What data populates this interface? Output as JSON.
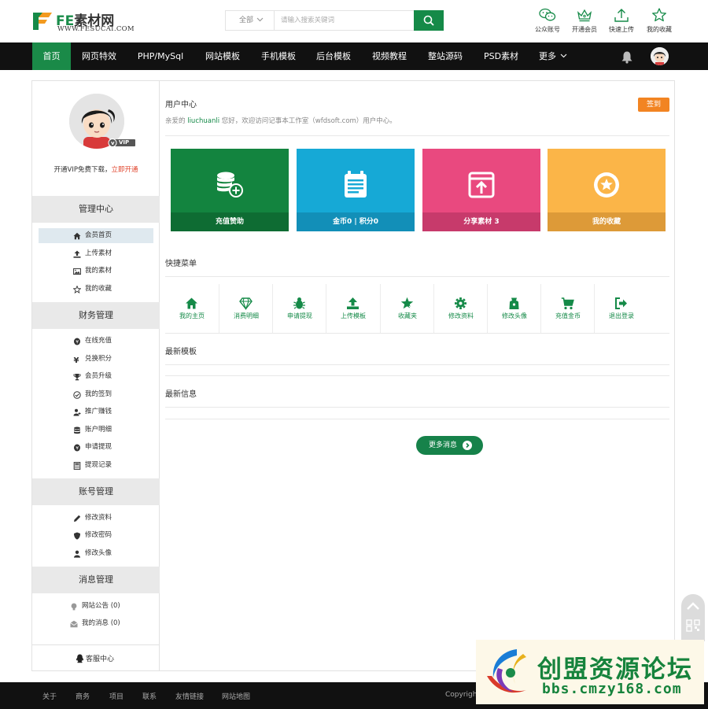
{
  "header": {
    "logo_fe": "FE",
    "logo_cn": "素材网",
    "logo_url": "WWW.FESUCAI.COM",
    "search": {
      "category": "全部",
      "placeholder": "请输入搜索关键词"
    },
    "quick_links": [
      {
        "label": "公众账号",
        "icon": "wechat-icon"
      },
      {
        "label": "开通会员",
        "icon": "crown-icon"
      },
      {
        "label": "快速上传",
        "icon": "upload-icon"
      },
      {
        "label": "我的收藏",
        "icon": "star-icon"
      }
    ]
  },
  "nav": {
    "items": [
      "首页",
      "网页特效",
      "PHP/MySql",
      "网站模板",
      "手机模板",
      "后台模板",
      "视频教程",
      "整站源码",
      "PSD素材",
      "更多"
    ],
    "active": "首页"
  },
  "sidebar": {
    "vip_badge": "VIP",
    "vip_text": "开通VIP免费下载，",
    "vip_link": "立即开通",
    "sections": [
      {
        "title": "管理中心",
        "items": [
          "会员首页",
          "上传素材",
          "我的素材",
          "我的收藏"
        ]
      },
      {
        "title": "财务管理",
        "items": [
          "在线充值",
          "兑换积分",
          "会员升级",
          "我的签到",
          "推广赚钱",
          "账户明细",
          "申请提现",
          "提现记录"
        ]
      },
      {
        "title": "账号管理",
        "items": [
          "修改资料",
          "修改密码",
          "修改头像"
        ]
      },
      {
        "title": "消息管理",
        "items": [
          "网站公告 (0)",
          "我的消息 (0)"
        ]
      }
    ],
    "service": "客服中心"
  },
  "main": {
    "title": "用户中心",
    "welcome_pre": "亲爱的 ",
    "username": "liuchuanli",
    "welcome_post": " 您好，欢迎访问记事本工作室（wfdsoft.com）用户中心。",
    "signin": "签到",
    "cards": [
      {
        "label": "充值赞助",
        "color": "#13843f",
        "foot": "#0e6c33",
        "icon": "coins-icon"
      },
      {
        "label": "金币0 | 积分0",
        "color": "#16a9d6",
        "foot": "#128fb8",
        "icon": "calendar-icon"
      },
      {
        "label": "分享素材 3",
        "color": "#e9497f",
        "foot": "#c73a6b",
        "icon": "share-icon"
      },
      {
        "label": "我的收藏",
        "color": "#fbb548",
        "foot": "#dd9a38",
        "icon": "favorite-icon"
      }
    ],
    "quick_menu_title": "快捷菜单",
    "quick_menu": [
      "我的主页",
      "消费明细",
      "申请提现",
      "上传模板",
      "收藏夹",
      "修改资料",
      "修改头像",
      "充值金币",
      "退出登录"
    ],
    "latest_templates": "最新模板",
    "latest_info": "最新信息",
    "more_button": "更多消息"
  },
  "footer": {
    "links": [
      "关于",
      "商务",
      "项目",
      "联系",
      "友情链接",
      "网站地图"
    ],
    "copyright": "Copyright"
  },
  "watermark": {
    "title": "创盟资源论坛",
    "url": "bbs.cmzy168.com"
  }
}
